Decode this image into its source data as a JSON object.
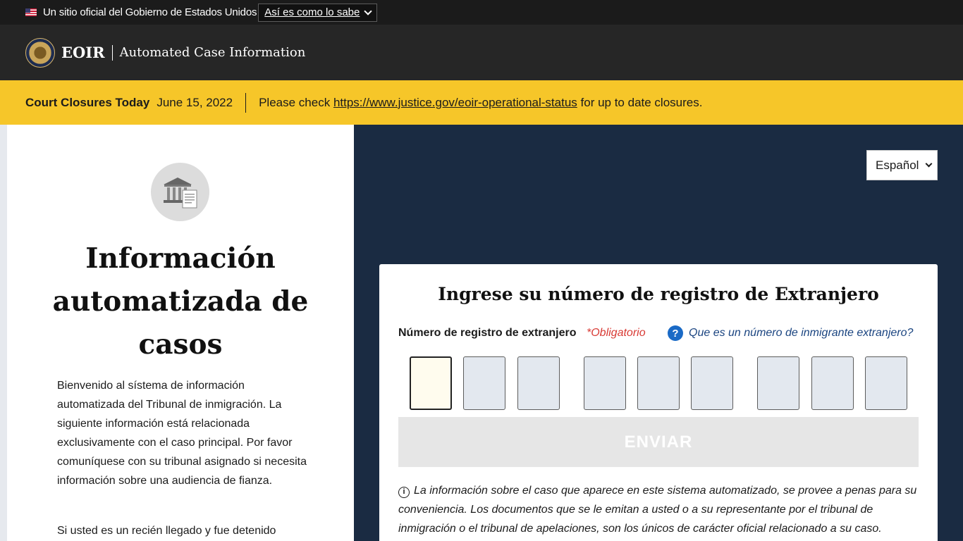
{
  "gov_banner": {
    "text": "Un sitio oficial del Gobierno de Estados Unidos",
    "toggle_label": "Así es como lo sabe"
  },
  "header": {
    "brand": "EOIR",
    "app_title": "Automated Case Information"
  },
  "alert": {
    "title": "Court Closures Today",
    "date": "June 15, 2022",
    "prefix": "Please check",
    "link": "https://www.justice.gov/eoir-operational-status",
    "suffix": "for up to date closures."
  },
  "left_panel": {
    "title": "Información automatizada de casos",
    "intro": "Bienvenido al sístema de información automatizada del Tribunal de inmigración. La siguiente información está relacionada exclusivamente con el caso principal. Por favor comuníquese con su tribunal asignado si necesita información sobre una audiencia de fianza.",
    "intro2": "Si usted es un recién llegado y fue detenido"
  },
  "language_select": {
    "selected": "Español"
  },
  "form": {
    "title": "Ingrese su número de registro de Extranjero",
    "field_label": "Número de registro de extranjero",
    "required_label": "*Obligatorio",
    "help_icon": "?",
    "help_link": "Que es un número de inmigrante extranjero?",
    "digits": [
      "",
      "",
      "",
      "",
      "",
      "",
      "",
      "",
      ""
    ],
    "submit_label": "ENVIAR",
    "info_icon": "i",
    "info_text": "La información sobre el caso que aparece en este sistema automatizado, se provee a penas para su conveniencia. Los documentos que se le emitan a usted o a su representante por el tribunal de inmigración o el tribunal de apelaciones, son los únicos de carácter oficial relacionado a su caso."
  }
}
